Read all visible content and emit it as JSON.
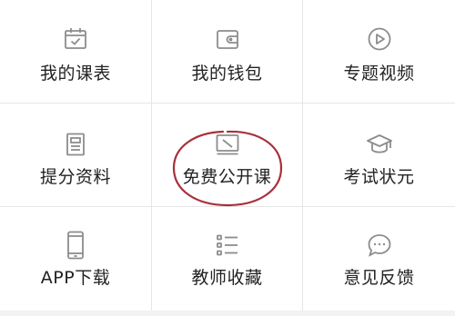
{
  "menu": {
    "items": [
      {
        "label": "我的课表",
        "icon": "calendar-icon"
      },
      {
        "label": "我的钱包",
        "icon": "wallet-icon"
      },
      {
        "label": "专题视频",
        "icon": "play-icon"
      },
      {
        "label": "提分资料",
        "icon": "document-icon"
      },
      {
        "label": "免费公开课",
        "icon": "whiteboard-icon"
      },
      {
        "label": "考试状元",
        "icon": "graduation-cap-icon"
      },
      {
        "label": "APP下载",
        "icon": "phone-icon"
      },
      {
        "label": "教师收藏",
        "icon": "list-icon"
      },
      {
        "label": "意见反馈",
        "icon": "chat-icon"
      }
    ]
  },
  "colors": {
    "icon_gray": "#8c8c8c",
    "highlight_red": "#a8303a",
    "text": "#222222"
  }
}
